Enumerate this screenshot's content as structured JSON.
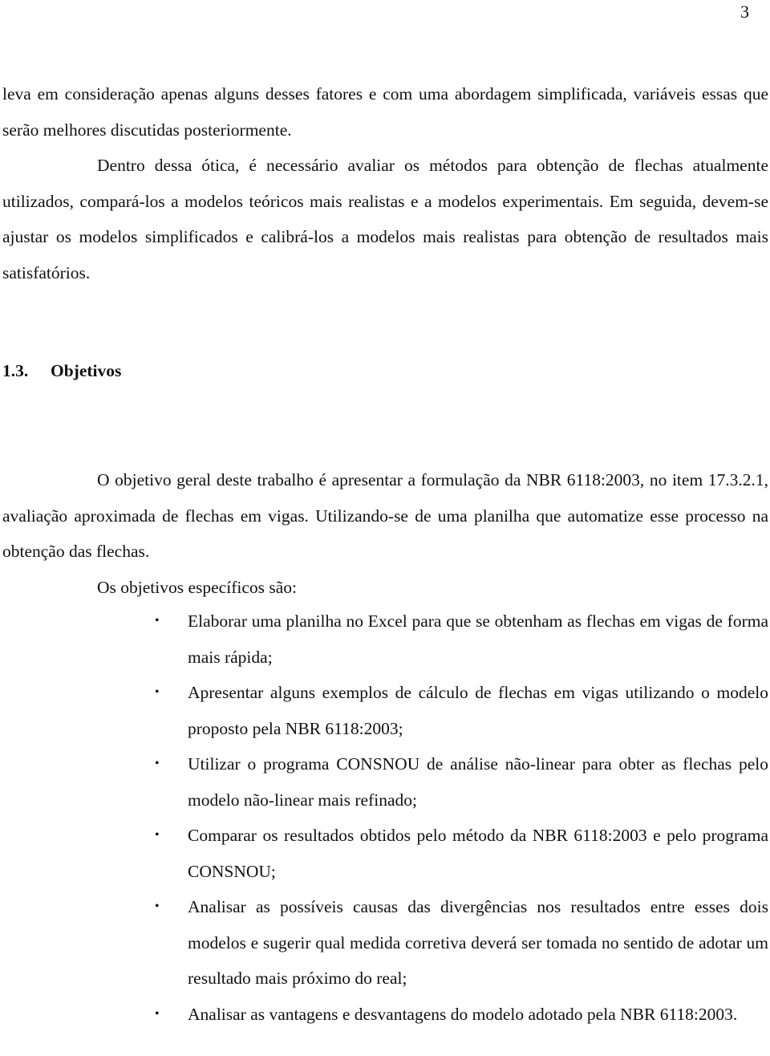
{
  "page_number": "3",
  "paragraphs_top": [
    {
      "text": "leva em consideração apenas alguns desses fatores e com uma abordagem simplificada, variáveis essas que serão melhores discutidas posteriormente."
    },
    {
      "text": "Dentro dessa ótica, é necessário avaliar os métodos para obtenção de flechas atualmente utilizados, compará-los a modelos teóricos mais realistas e a modelos experimentais. Em seguida, devem-se ajustar os modelos simplificados e calibrá-los a modelos mais realistas para obtenção de resultados mais satisfatórios."
    }
  ],
  "section": {
    "number": "1.3.",
    "title": "Objetivos"
  },
  "paragraphs_section": [
    {
      "text": "O objetivo geral deste trabalho é apresentar a formulação da NBR 6118:2003, no item 17.3.2.1, avaliação aproximada de flechas em vigas. Utilizando-se de uma planilha que automatize esse processo na obtenção das flechas."
    },
    {
      "text": "Os objetivos específicos são:"
    }
  ],
  "bullet_glyph": "•",
  "objectives": [
    "Elaborar uma planilha no Excel para que se obtenham as flechas em vigas de forma mais rápida;",
    "Apresentar alguns exemplos de cálculo de flechas em vigas utilizando o modelo proposto pela NBR 6118:2003;",
    "Utilizar o programa CONSNOU de análise não-linear para obter as flechas pelo modelo não-linear mais refinado;",
    "Comparar os resultados obtidos pelo método da NBR 6118:2003 e pelo programa CONSNOU;",
    "Analisar as possíveis causas das divergências nos resultados entre esses dois modelos e sugerir qual medida corretiva deverá ser tomada no sentido de adotar um resultado mais próximo do real;",
    "Analisar as vantagens e desvantagens do modelo adotado pela NBR 6118:2003."
  ]
}
